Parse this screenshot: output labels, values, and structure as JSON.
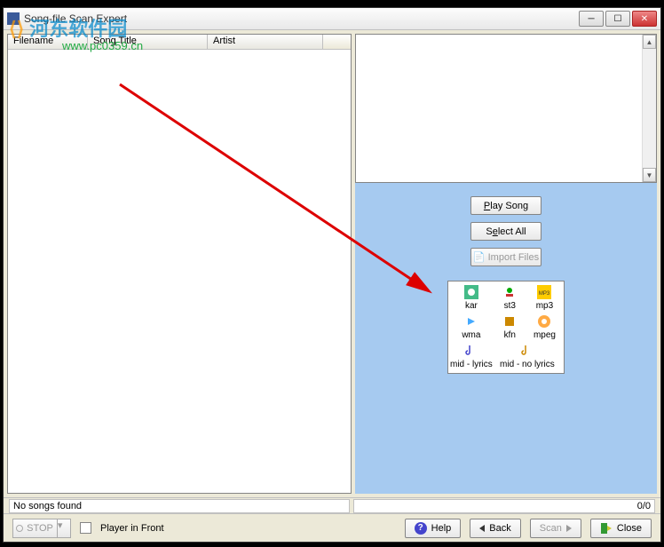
{
  "titlebar": {
    "title": "Song-file Scan Expert"
  },
  "table": {
    "headers": [
      "Filename",
      "Song Title",
      "Artist"
    ]
  },
  "buttons": {
    "play_song": "Play Song",
    "select_all": "Select All",
    "import_files": "Import Files"
  },
  "formats": {
    "items": [
      {
        "name": "kar",
        "icon_bg": "#4b8",
        "icon_fg": "#fff"
      },
      {
        "name": "st3",
        "icon_bg": "#0a0",
        "icon_fg": "#fff"
      },
      {
        "name": "mp3",
        "icon_bg": "#ffcc00",
        "icon_fg": "#333"
      },
      {
        "name": "wma",
        "icon_bg": "#4af",
        "icon_fg": "#fff"
      },
      {
        "name": "kfn",
        "icon_bg": "#c80",
        "icon_fg": "#fff"
      },
      {
        "name": "mpeg",
        "icon_bg": "#fa4",
        "icon_fg": "#fff"
      }
    ],
    "mid_lyrics": "mid - lyrics",
    "mid_no_lyrics": "mid - no lyrics"
  },
  "status": {
    "left": "No songs found",
    "right": "0/0"
  },
  "bottom": {
    "stop": "STOP",
    "player_in_front": "Player in Front",
    "help": "Help",
    "back": "Back",
    "scan": "Scan",
    "close": "Close"
  },
  "watermark": {
    "main": "河东软件园",
    "url": "www.pc0359.cn"
  }
}
